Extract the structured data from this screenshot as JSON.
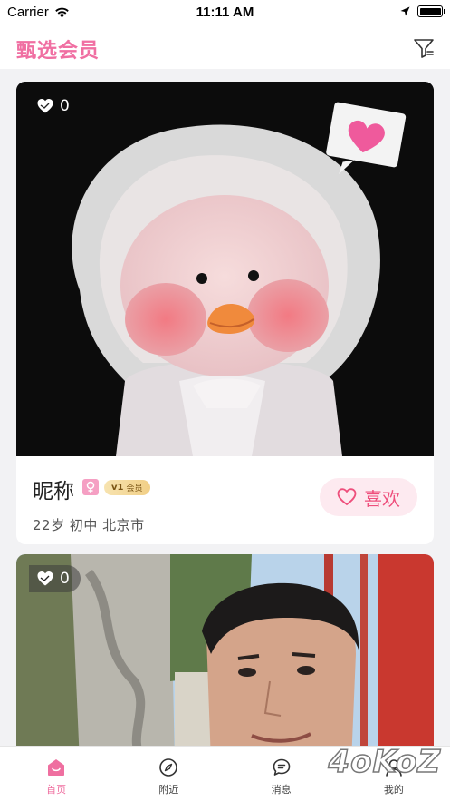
{
  "status_bar": {
    "carrier": "Carrier",
    "time": "11:11 AM"
  },
  "header": {
    "title": "甄选会员"
  },
  "cards": [
    {
      "like_count": "0",
      "nickname": "昵称",
      "vip_level": "v1",
      "vip_text": "会员",
      "info": "22岁  初中  北京市",
      "like_button": "喜欢"
    },
    {
      "like_count": "0"
    }
  ],
  "tabs": [
    {
      "label": "首页",
      "icon": "home-icon",
      "active": true
    },
    {
      "label": "附近",
      "icon": "compass-icon",
      "active": false
    },
    {
      "label": "消息",
      "icon": "message-icon",
      "active": false
    },
    {
      "label": "我的",
      "icon": "user-icon",
      "active": false
    }
  ],
  "watermark": "4oKoZ",
  "colors": {
    "accent": "#f06fa2",
    "like_red": "#ee4f7c",
    "like_bg": "#fdeaf0"
  }
}
